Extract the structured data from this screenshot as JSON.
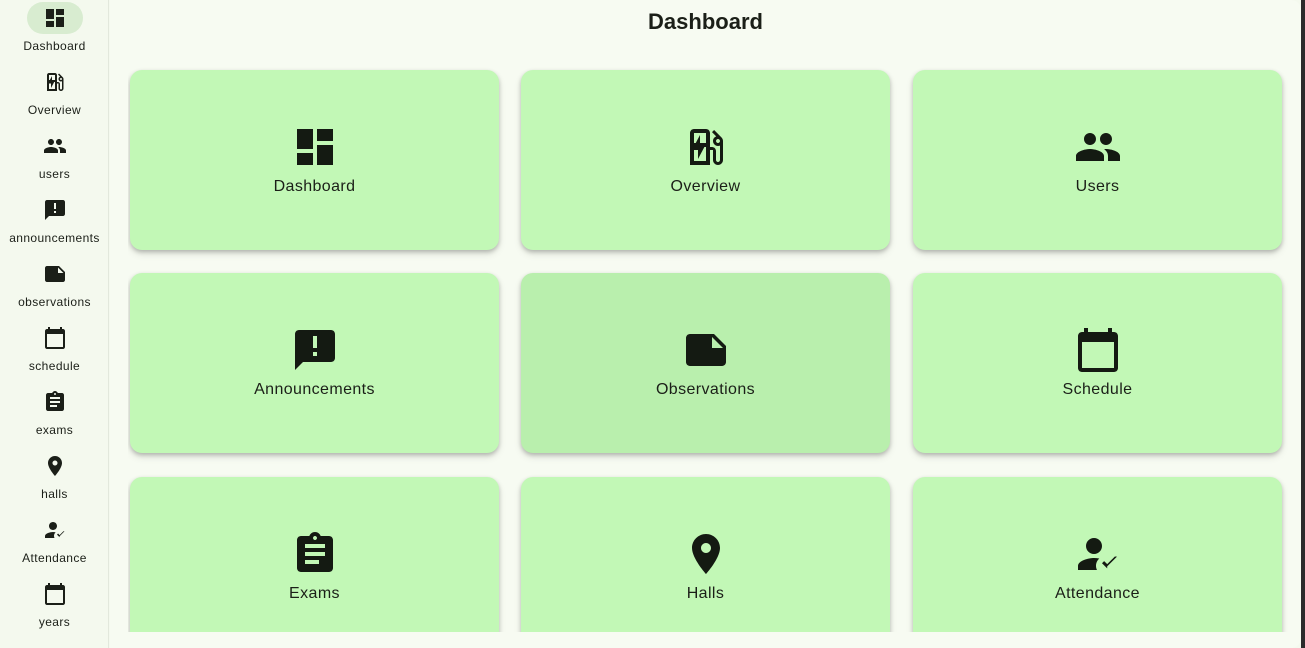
{
  "page": {
    "title": "Dashboard"
  },
  "sidebar": {
    "active": "Dashboard",
    "items": [
      {
        "label": "Dashboard",
        "icon": "dashboard-icon"
      },
      {
        "label": "Overview",
        "icon": "ev-station-icon"
      },
      {
        "label": "users",
        "icon": "people-icon"
      },
      {
        "label": "announcements",
        "icon": "announcement-icon"
      },
      {
        "label": "observations",
        "icon": "sticky-note-icon"
      },
      {
        "label": "schedule",
        "icon": "calendar-icon"
      },
      {
        "label": "exams",
        "icon": "assignment-icon"
      },
      {
        "label": "halls",
        "icon": "location-pin-icon"
      },
      {
        "label": "Attendance",
        "icon": "person-check-icon"
      },
      {
        "label": "years",
        "icon": "calendar-icon"
      }
    ]
  },
  "cards": [
    {
      "label": "Dashboard",
      "icon": "dashboard-icon"
    },
    {
      "label": "Overview",
      "icon": "ev-station-icon"
    },
    {
      "label": "Users",
      "icon": "people-icon"
    },
    {
      "label": "Announcements",
      "icon": "announcement-icon"
    },
    {
      "label": "Observations",
      "icon": "sticky-note-icon"
    },
    {
      "label": "Schedule",
      "icon": "calendar-icon"
    },
    {
      "label": "Exams",
      "icon": "assignment-icon"
    },
    {
      "label": "Halls",
      "icon": "location-pin-icon"
    },
    {
      "label": "Attendance",
      "icon": "person-check-icon"
    }
  ],
  "colors": {
    "card_bg": "#c2f8b6",
    "card_hover_bg": "#b9efad",
    "page_bg": "#f7fbf2",
    "rail_active_bg": "#d8ecd0"
  }
}
